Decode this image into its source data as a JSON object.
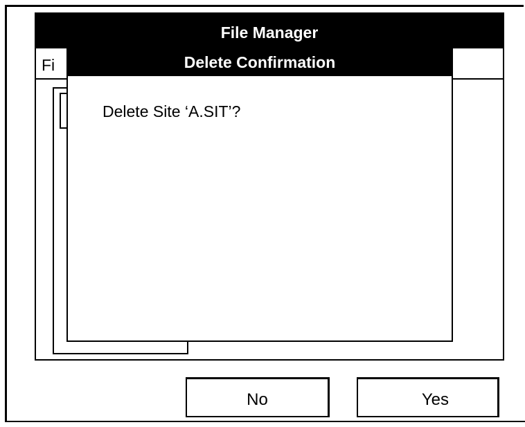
{
  "window": {
    "title": "File Manager",
    "menu_file_partial": "Fi"
  },
  "dialog": {
    "title": "Delete Confirmation",
    "message": "Delete Site ‘A.SIT’?"
  },
  "buttons": {
    "no_label": "No",
    "yes_label": "Yes"
  },
  "colors": {
    "titlebar_bg": "#000000",
    "titlebar_fg": "#ffffff",
    "background": "#ffffff",
    "border": "#000000"
  }
}
